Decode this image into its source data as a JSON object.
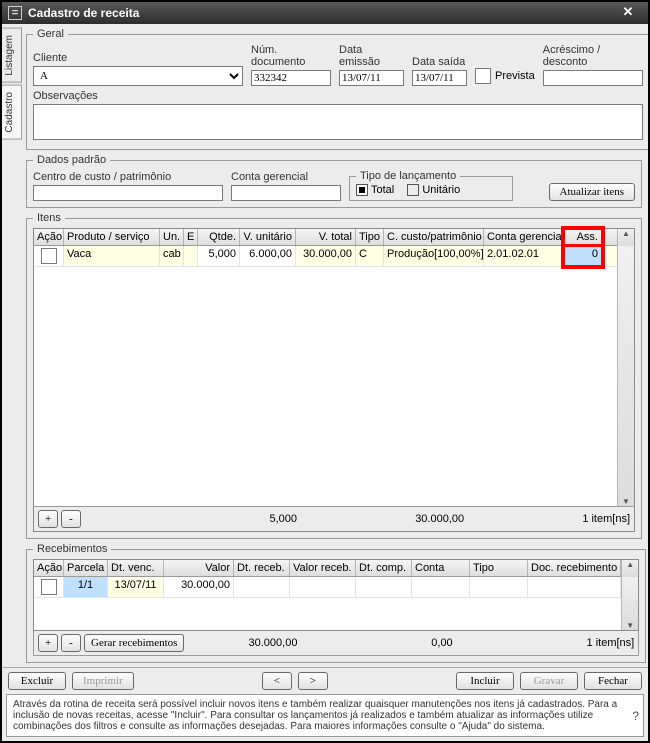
{
  "window": {
    "title": "Cadastro de receita"
  },
  "tabs": {
    "listagem": "Listagem",
    "cadastro": "Cadastro"
  },
  "geral": {
    "legend": "Geral",
    "cliente_label": "Cliente",
    "cliente_value": "A",
    "numdoc_label": "Núm. documento",
    "numdoc_value": "332342",
    "emissao_label": "Data emissão",
    "emissao_value": "13/07/11",
    "saida_label": "Data saída",
    "saida_value": "13/07/11",
    "prevista_label": "Prevista",
    "acrescimo_label": "Acréscimo / desconto",
    "obs_label": "Observações",
    "obs_value": ""
  },
  "dados": {
    "legend": "Dados padrão",
    "centro_label": "Centro de custo / patrimônio",
    "conta_label": "Conta gerencial",
    "tipo_legend": "Tipo de lançamento",
    "tipo_total": "Total",
    "tipo_unitario": "Unitário",
    "atualizar": "Atualizar itens"
  },
  "itens": {
    "legend": "Itens",
    "headers": {
      "acao": "Ação",
      "produto": "Produto / serviço",
      "un": "Un.",
      "e": "E",
      "qtde": "Qtde.",
      "vunit": "V. unitário",
      "vtotal": "V. total",
      "tipo": "Tipo",
      "ccusto": "C. custo/patrimônio",
      "cgerencial": "Conta gerencial",
      "ass": "Ass."
    },
    "rows": [
      {
        "produto": "Vaca",
        "un": "cab",
        "e": "",
        "qtde": "5,000",
        "vunit": "6.000,00",
        "vtotal": "30.000,00",
        "tipo": "C",
        "ccusto": "Produção[100,00%]",
        "cgerencial": "2.01.02.01",
        "ass": "0"
      }
    ],
    "footer": {
      "qtde": "5,000",
      "total": "30.000,00",
      "count": "1 item[ns]"
    }
  },
  "receb": {
    "legend": "Recebimentos",
    "headers": {
      "acao": "Ação",
      "parcela": "Parcela",
      "dtvenc": "Dt. venc.",
      "valor": "Valor",
      "dtreceb": "Dt. receb.",
      "valorreceb": "Valor receb.",
      "dtcomp": "Dt. comp.",
      "conta": "Conta",
      "tipo": "Tipo",
      "docreceb": "Doc. recebimento"
    },
    "rows": [
      {
        "parcela": "1/1",
        "dtvenc": "13/07/11",
        "valor": "30.000,00"
      }
    ],
    "footer": {
      "gerar": "Gerar recebimentos",
      "total": "30.000,00",
      "receb": "0,00",
      "count": "1 item[ns]"
    }
  },
  "actions": {
    "excluir": "Excluir",
    "imprimir": "Imprimir",
    "prev": "<",
    "next": ">",
    "incluir": "Incluir",
    "gravar": "Gravar",
    "fechar": "Fechar"
  },
  "help": {
    "text": "Através da rotina de receita será possível incluir novos itens e também realizar quaisquer manutenções nos itens já cadastrados. Para a inclusão de novas receitas, acesse \"Incluir\". Para consultar os lançamentos já realizados e também atualizar as informações utilize combinações dos filtros e consulte as informações desejadas. Para maiores informações consulte o \"Ajuda\" do sistema."
  }
}
